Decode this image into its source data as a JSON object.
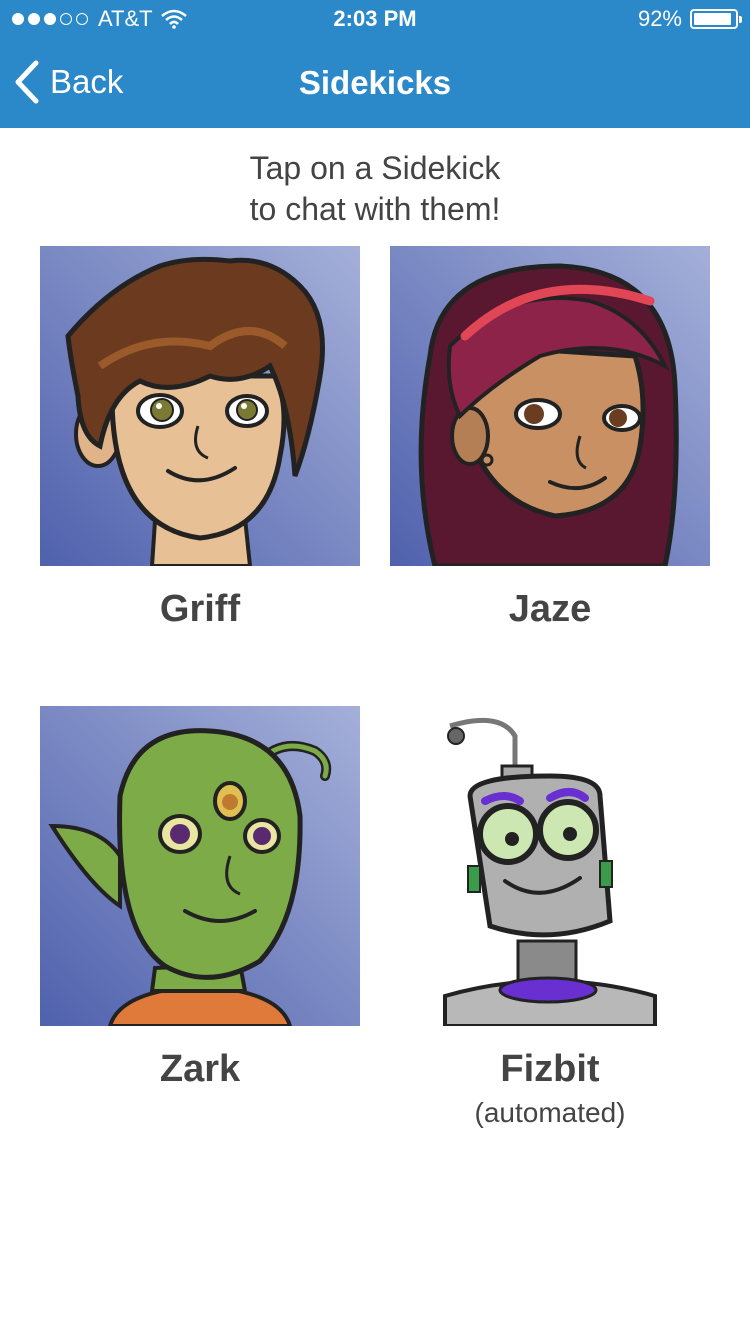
{
  "status_bar": {
    "carrier": "AT&T",
    "time": "2:03 PM",
    "battery": "92%",
    "battery_level": 0.92,
    "signal_bars_filled": 3,
    "signal_bars_total": 5
  },
  "nav": {
    "back_label": "Back",
    "title": "Sidekicks"
  },
  "instructions": {
    "line1": "Tap on a Sidekick",
    "line2": "to chat with them!"
  },
  "sidekicks": [
    {
      "name": "Griff"
    },
    {
      "name": "Jaze"
    },
    {
      "name": "Zark"
    },
    {
      "name": "Fizbit",
      "note": "(automated)"
    }
  ],
  "colors": {
    "header": "#2b88c9",
    "text": "#444444",
    "portrait_background": "#7d8fc4"
  }
}
